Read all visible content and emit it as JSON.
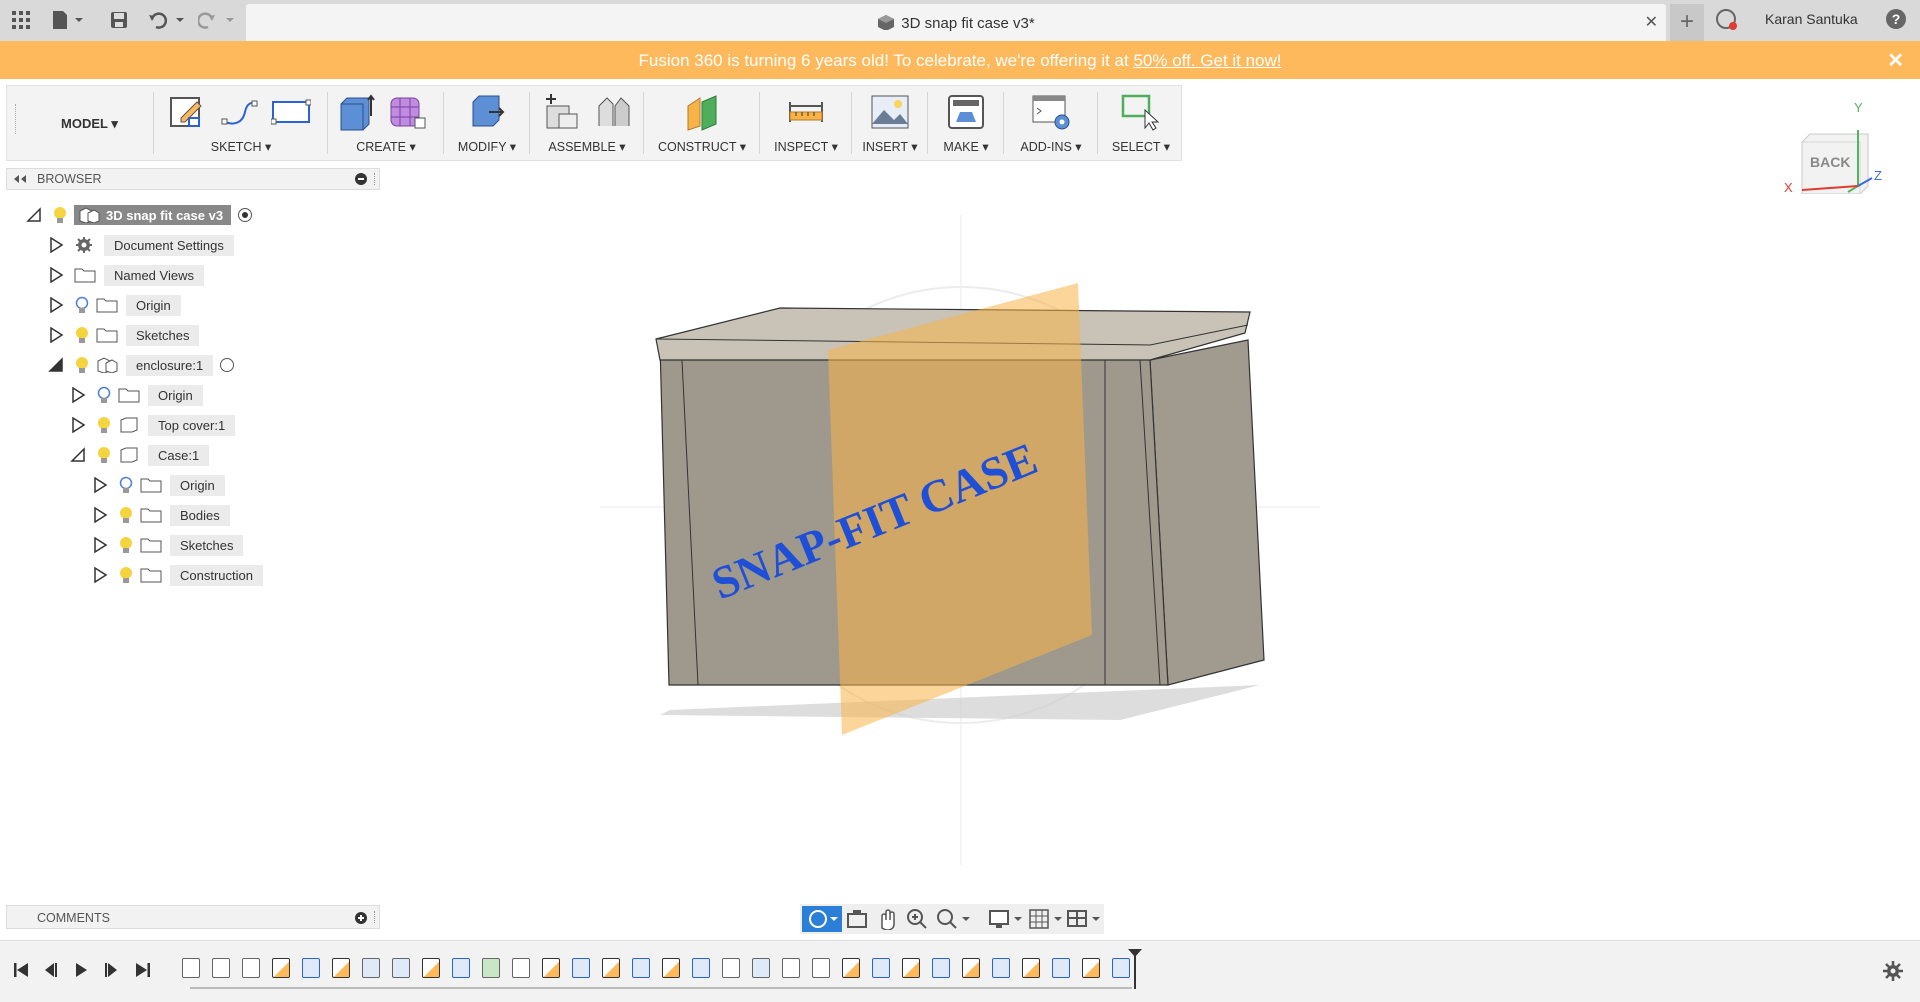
{
  "titlebar": {
    "document_title": "3D snap fit case v3*",
    "user_name": "Karan Santuka",
    "help_label": "?"
  },
  "banner": {
    "text": "Fusion 360 is turning 6 years old! To celebrate, we're offering it at ",
    "link": "50% off. Get it now!"
  },
  "toolbar": {
    "workspace": "MODEL",
    "groups": [
      "SKETCH",
      "CREATE",
      "MODIFY",
      "ASSEMBLE",
      "CONSTRUCT",
      "INSPECT",
      "INSERT",
      "MAKE",
      "ADD-INS",
      "SELECT"
    ]
  },
  "browser": {
    "title": "BROWSER",
    "items": [
      {
        "label": "3D snap fit case v3"
      },
      {
        "label": "Document Settings"
      },
      {
        "label": "Named Views"
      },
      {
        "label": "Origin"
      },
      {
        "label": "Sketches"
      },
      {
        "label": "enclosure:1"
      },
      {
        "label": "Origin"
      },
      {
        "label": "Top cover:1"
      },
      {
        "label": "Case:1"
      },
      {
        "label": "Origin"
      },
      {
        "label": "Bodies"
      },
      {
        "label": "Sketches"
      },
      {
        "label": "Construction"
      }
    ]
  },
  "comments": {
    "title": "COMMENTS"
  },
  "viewport": {
    "model_text": "SNAP-FIT CASE",
    "viewcube_label": "BACK",
    "axes": {
      "x": "X",
      "y": "Y",
      "z": "Z"
    }
  },
  "colors": {
    "banner": "#fdb95c",
    "model_text": "#1f4fd6",
    "plane": "#f7b347"
  }
}
